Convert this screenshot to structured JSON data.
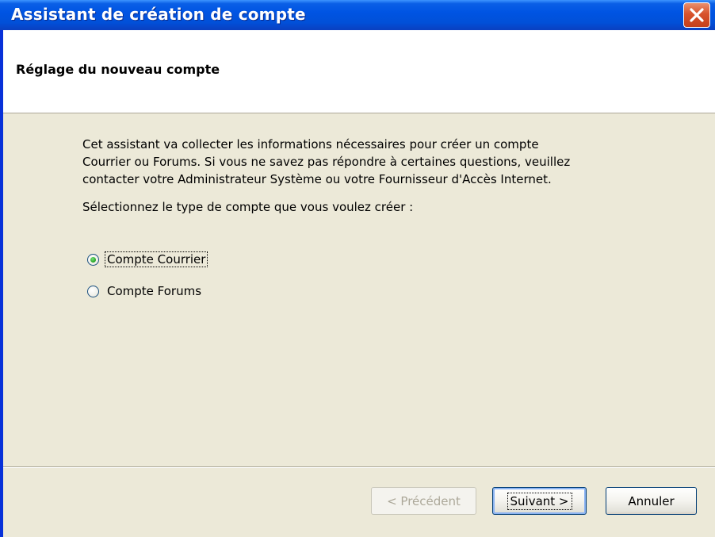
{
  "window": {
    "title": "Assistant de création de compte",
    "close_icon": "close-icon"
  },
  "header": {
    "title": "Réglage du nouveau compte"
  },
  "intro": {
    "line1": "Cet assistant va collecter les informations nécessaires pour créer un compte",
    "line2": "Courrier ou Forums. Si vous ne savez pas répondre à certaines questions, veuillez",
    "line3": "contacter votre Administrateur Système ou votre Fournisseur d'Accès Internet."
  },
  "prompt": "Sélectionnez le type de compte que vous voulez créer :",
  "account_types": [
    {
      "label": "Compte Courrier",
      "selected": true
    },
    {
      "label": "Compte Forums",
      "selected": false
    }
  ],
  "buttons": {
    "previous": "< Précédent",
    "next": "Suivant >",
    "cancel": "Annuler"
  },
  "colors": {
    "titlebar": "#0054e3",
    "dialog_bg": "#ece9d8",
    "close_button": "#d8532c",
    "radio_selected": "#21a121"
  }
}
